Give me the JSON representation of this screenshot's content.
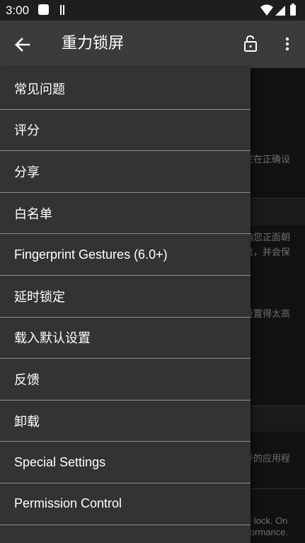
{
  "status_bar": {
    "time": "3:00",
    "icons": [
      "notification-square-icon",
      "notification-bars-icon",
      "wifi-icon",
      "cell-signal-icon",
      "battery-icon"
    ]
  },
  "app_bar": {
    "title": "重力锁屏",
    "back_icon": "arrow-back-icon",
    "lock_icon": "lock-open-icon",
    "more_icon": "more-vert-icon"
  },
  "drawer": {
    "items": [
      {
        "label": "常见问题"
      },
      {
        "label": "评分"
      },
      {
        "label": "分享"
      },
      {
        "label": "白名单"
      },
      {
        "label": "Fingerprint Gestures (6.0+)"
      },
      {
        "label": "延时锁定"
      },
      {
        "label": "载入默认设置"
      },
      {
        "label": "反馈"
      },
      {
        "label": "卸载"
      },
      {
        "label": "Special Settings"
      },
      {
        "label": "Permission Control"
      }
    ]
  },
  "background": {
    "fragments": [
      "定在正确设",
      "确您正面朝",
      "桌，并会保",
      "设置得太高",
      "开的应用程",
      "ld lock. On",
      "rformance."
    ]
  },
  "colors": {
    "status_bar": "#1e1e1e",
    "app_bar": "#3b3b3b",
    "drawer": "#333333",
    "divider": "#8f8f8f",
    "text": "#ffffff"
  }
}
